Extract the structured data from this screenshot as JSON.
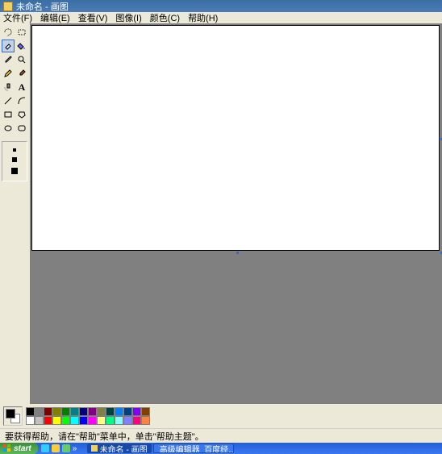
{
  "window": {
    "title": "未命名 - 画图"
  },
  "menu": {
    "file": "文件(F)",
    "edit": "编辑(E)",
    "view": "查看(V)",
    "image": "图像(I)",
    "colors": "颜色(C)",
    "help": "帮助(H)"
  },
  "tools": {
    "freeform_select": "free-form-select",
    "rect_select": "rect-select",
    "eraser": "eraser",
    "fill": "fill",
    "picker": "color-picker",
    "magnifier": "magnifier",
    "pencil": "pencil",
    "brush": "brush",
    "airbrush": "airbrush",
    "text": "text",
    "line": "line",
    "curve": "curve",
    "rectangle": "rectangle",
    "polygon": "polygon",
    "ellipse": "ellipse",
    "rounded_rect": "rounded-rectangle"
  },
  "current_colors": {
    "fg": "#000000",
    "bg": "#ffffff"
  },
  "palette_row1": [
    "#000000",
    "#808080",
    "#800000",
    "#808000",
    "#008000",
    "#008080",
    "#000080",
    "#800080",
    "#808040",
    "#004040",
    "#0080ff",
    "#004080",
    "#8000ff",
    "#804000"
  ],
  "palette_row2": [
    "#ffffff",
    "#c0c0c0",
    "#ff0000",
    "#ffff00",
    "#00ff00",
    "#00ffff",
    "#0000ff",
    "#ff00ff",
    "#ffff80",
    "#00ff80",
    "#80ffff",
    "#8080ff",
    "#ff0080",
    "#ff8040"
  ],
  "status": {
    "help_text": "要获得帮助，请在\"帮助\"菜单中，单击\"帮助主题\"。"
  },
  "taskbar": {
    "start": "start",
    "task1": "未命名 - 画图",
    "task2": "高级编辑器_百度经…"
  }
}
